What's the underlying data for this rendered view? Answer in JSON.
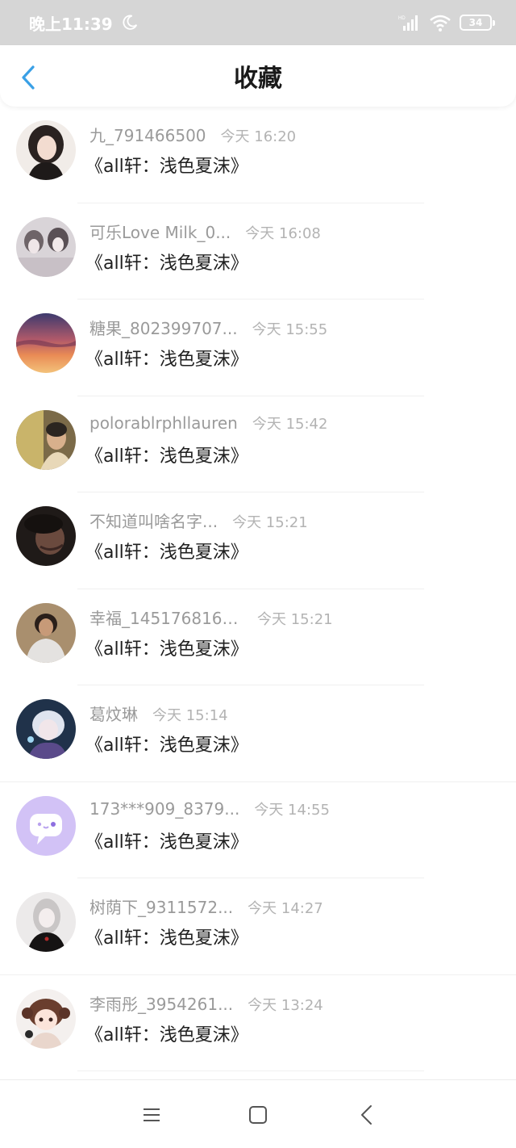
{
  "status_bar": {
    "time": "晚上11:39",
    "battery": "34",
    "icons": [
      "moon-icon",
      "signal-icon",
      "wifi-icon",
      "battery-icon"
    ]
  },
  "header": {
    "title": "收藏",
    "back_icon": "chevron-left-icon"
  },
  "colors": {
    "accent": "#3aa0e6",
    "status_bar_bg": "#d6d6d6",
    "name_text": "#9a9a9a",
    "time_text": "#b3b3b3"
  },
  "items": [
    {
      "user": "九_791466500",
      "time": "今天 16:20",
      "title": "《all轩：浅色夏沫》"
    },
    {
      "user": "可乐Love Milk_0...",
      "time": "今天 16:08",
      "title": "《all轩：浅色夏沫》"
    },
    {
      "user": "糖果_802399707...",
      "time": "今天 15:55",
      "title": "《all轩：浅色夏沫》"
    },
    {
      "user": "polorablrphllauren",
      "time": "今天 15:42",
      "title": "《all轩：浅色夏沫》"
    },
    {
      "user": "不知道叫啥名字...",
      "time": "今天 15:21",
      "title": "《all轩：浅色夏沫》"
    },
    {
      "user": "幸福_1451768162...",
      "time": "今天 15:21",
      "title": "《all轩：浅色夏沫》"
    },
    {
      "user": "葛炆琳",
      "time": "今天 15:14",
      "title": "《all轩：浅色夏沫》"
    },
    {
      "user": "173***909_8379...",
      "time": "今天 14:55",
      "title": "《all轩：浅色夏沫》"
    },
    {
      "user": "树荫下_9311572...",
      "time": "今天 14:27",
      "title": "《all轩：浅色夏沫》"
    },
    {
      "user": "李雨彤_3954261...",
      "time": "今天 13:24",
      "title": "《all轩：浅色夏沫》"
    }
  ],
  "nav_bar": {
    "icons": [
      "menu-nav-icon",
      "home-nav-icon",
      "back-nav-icon"
    ]
  }
}
